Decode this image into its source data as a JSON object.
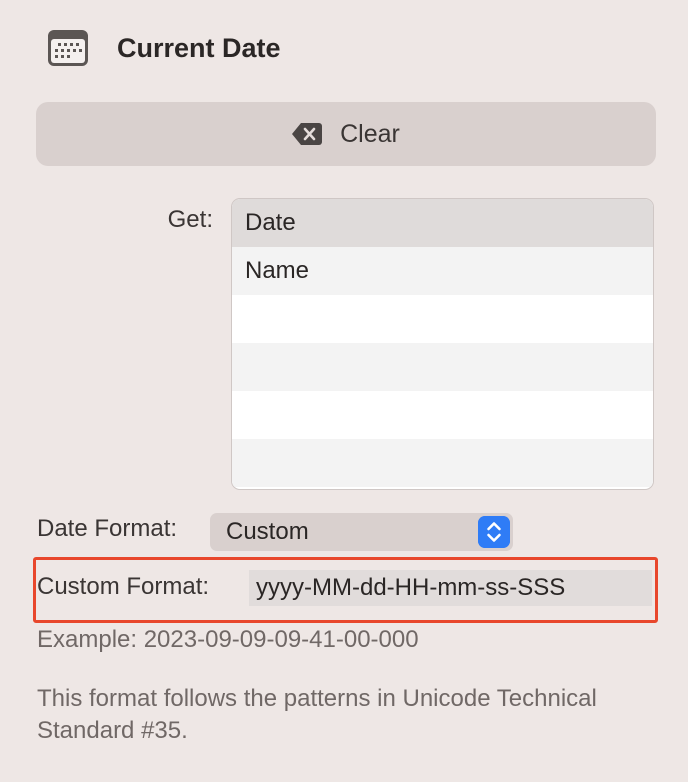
{
  "header": {
    "title": "Current Date",
    "icon": "calendar-icon"
  },
  "clear_button": {
    "label": "Clear",
    "icon": "delete-left-icon"
  },
  "get": {
    "label": "Get:",
    "items": [
      {
        "label": "Date",
        "selected": true
      },
      {
        "label": "Name",
        "selected": false
      },
      {
        "label": "",
        "selected": false
      },
      {
        "label": "",
        "selected": false
      },
      {
        "label": "",
        "selected": false
      }
    ]
  },
  "date_format": {
    "label": "Date Format:",
    "selected": "Custom"
  },
  "custom_format": {
    "label": "Custom Format:",
    "value": "yyyy-MM-dd-HH-mm-ss-SSS"
  },
  "example": "Example: 2023-09-09-09-41-00-000",
  "note": "This format follows the patterns in Unicode Technical Standard #35.",
  "colors": {
    "highlight": "#e8472c",
    "accent": "#2f7cf6"
  }
}
